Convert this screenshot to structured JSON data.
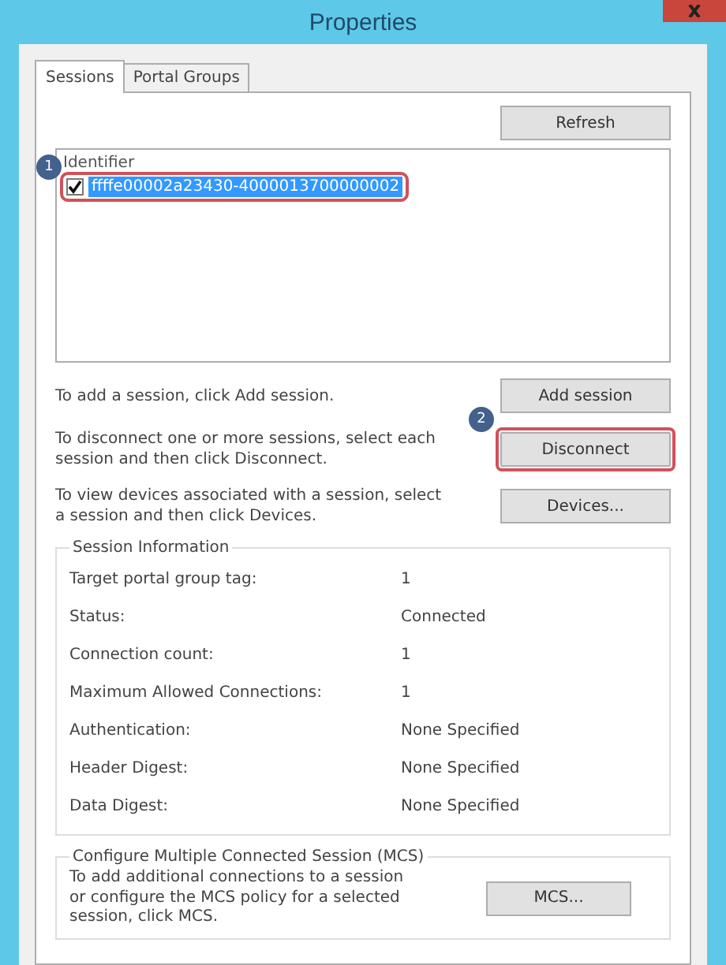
{
  "window": {
    "title": "Properties"
  },
  "tabs": [
    {
      "label": "Sessions",
      "selected": true
    },
    {
      "label": "Portal Groups",
      "selected": false
    }
  ],
  "refresh_button": "Refresh",
  "session_list": {
    "header": "Identifier",
    "callout": "1",
    "items": [
      {
        "identifier": "ffffe00002a23430-4000013700000002",
        "checked": true,
        "selected": true,
        "outlined": true
      }
    ]
  },
  "actions": [
    {
      "text": "To add a session, click Add session.",
      "button": "Add session",
      "outlined": false
    },
    {
      "text": "To disconnect one or more sessions, select each session and then click Disconnect.",
      "button": "Disconnect",
      "outlined": true,
      "callout": "2"
    },
    {
      "text": "To view devices associated with a session, select a session and then click Devices.",
      "button": "Devices...",
      "outlined": false
    }
  ],
  "session_information": {
    "title": "Session Information",
    "rows": [
      {
        "label": "Target portal group tag:",
        "value": "1"
      },
      {
        "label": "Status:",
        "value": "Connected"
      },
      {
        "label": "Connection count:",
        "value": "1"
      },
      {
        "label": "Maximum Allowed Connections:",
        "value": "1"
      },
      {
        "label": "Authentication:",
        "value": "None Specified"
      },
      {
        "label": "Header Digest:",
        "value": "None Specified"
      },
      {
        "label": "Data Digest:",
        "value": "None Specified"
      }
    ]
  },
  "mcs": {
    "title": "Configure Multiple Connected Session (MCS)",
    "text": "To add additional connections to a session or configure the MCS policy for a selected session, click MCS.",
    "button": "MCS..."
  }
}
